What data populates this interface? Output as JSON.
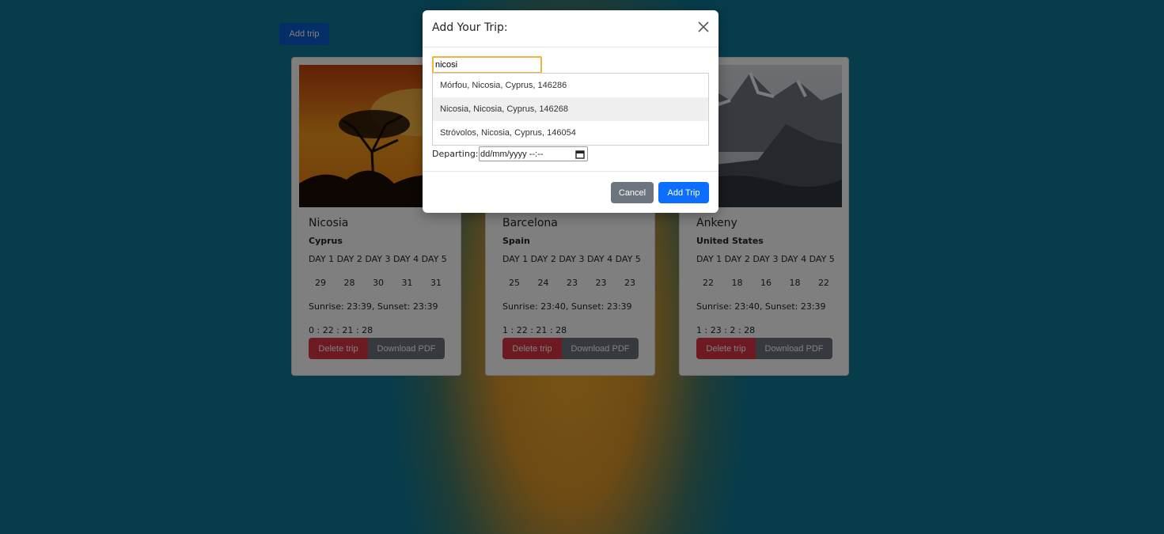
{
  "toolbar": {
    "add_trip_label": "Add trip"
  },
  "cards": [
    {
      "city": "Nicosia",
      "country": "Cyprus",
      "days_label": "DAY 1 DAY 2 DAY 3 DAY 4 DAY 5",
      "temps": [
        "29",
        "28",
        "30",
        "31",
        "31"
      ],
      "sun": "Sunrise: 23:39, Sunset: 23:39",
      "countdown": "0 : 22 : 21 : 28",
      "delete_label": "Delete trip",
      "pdf_label": "Download PDF"
    },
    {
      "city": "Barcelona",
      "country": "Spain",
      "days_label": "DAY 1 DAY 2 DAY 3 DAY 4 DAY 5",
      "temps": [
        "25",
        "24",
        "23",
        "23",
        "23"
      ],
      "sun": "Sunrise: 23:40, Sunset: 23:39",
      "countdown": "1 : 22 : 21 : 28",
      "delete_label": "Delete trip",
      "pdf_label": "Download PDF"
    },
    {
      "city": "Ankeny",
      "country": "United States",
      "days_label": "DAY 1 DAY 2 DAY 3 DAY 4 DAY 5",
      "temps": [
        "22",
        "18",
        "16",
        "18",
        "22"
      ],
      "sun": "Sunrise: 23:40, Sunset: 23:39",
      "countdown": "1 : 23 : 2 : 28",
      "delete_label": "Delete trip",
      "pdf_label": "Download PDF"
    }
  ],
  "modal": {
    "title": "Add Your Trip:",
    "search_value": "nicosi",
    "suggestions": [
      "Mórfou, Nicosia, Cyprus, 146286",
      "Nicosia, Nicosia, Cyprus, 146268",
      "Stróvolos, Nicosia, Cyprus, 146054"
    ],
    "departing_label": "Departing:",
    "date_placeholder": "dd/mm/yyyy --:--",
    "cancel_label": "Cancel",
    "submit_label": "Add Trip"
  },
  "colors": {
    "primary": "#0d6efd",
    "danger": "#dc3545",
    "secondary": "#6c757d",
    "input_focus": "#f2b13d"
  },
  "icons": {
    "close": "close-icon",
    "calendar": "calendar-icon"
  }
}
